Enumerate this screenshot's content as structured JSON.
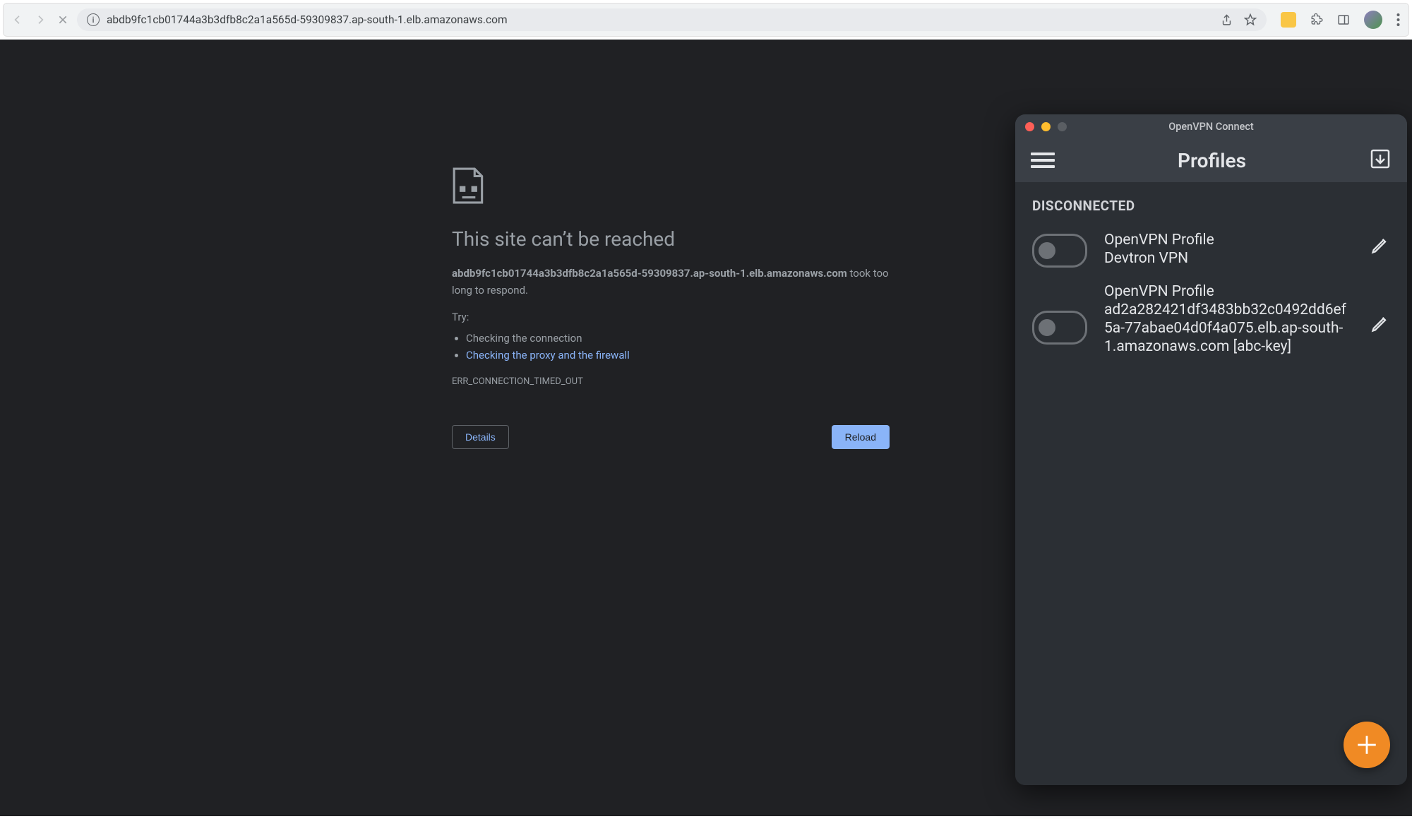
{
  "browser": {
    "url": "abdb9fc1cb01744a3b3dfb8c2a1a565d-59309837.ap-south-1.elb.amazonaws.com",
    "nav": {
      "back": "back",
      "forward": "forward",
      "stop": "stop"
    },
    "address_bar_icons": {
      "share": "share",
      "star": "bookmark"
    },
    "toolbar_icons": {
      "extensions": "extensions",
      "panel": "sidepanel",
      "menu": "more"
    }
  },
  "error": {
    "title": "This site can’t be reached",
    "host_bold": "abdb9fc1cb01744a3b3dfb8c2a1a565d-59309837.ap-south-1.elb.amazonaws.com",
    "host_tail": " took too long to respond.",
    "try_label": "Try:",
    "suggestion1": "Checking the connection",
    "suggestion2": "Checking the proxy and the firewall",
    "code": "ERR_CONNECTION_TIMED_OUT",
    "details_btn": "Details",
    "reload_btn": "Reload"
  },
  "vpn": {
    "window_title": "OpenVPN Connect",
    "header_title": "Profiles",
    "section_label": "DISCONNECTED",
    "profiles": [
      {
        "type": "OpenVPN Profile",
        "name": "Devtron VPN",
        "connected": false
      },
      {
        "type": "OpenVPN Profile",
        "name": "ad2a282421df3483bb32c0492dd6ef5a-77abae04d0f4a075.elb.ap-south-1.amazonaws.com [abc-key]",
        "connected": false
      }
    ],
    "icons": {
      "menu": "hamburger",
      "import": "import-profile",
      "edit": "pencil",
      "add": "plus"
    }
  }
}
